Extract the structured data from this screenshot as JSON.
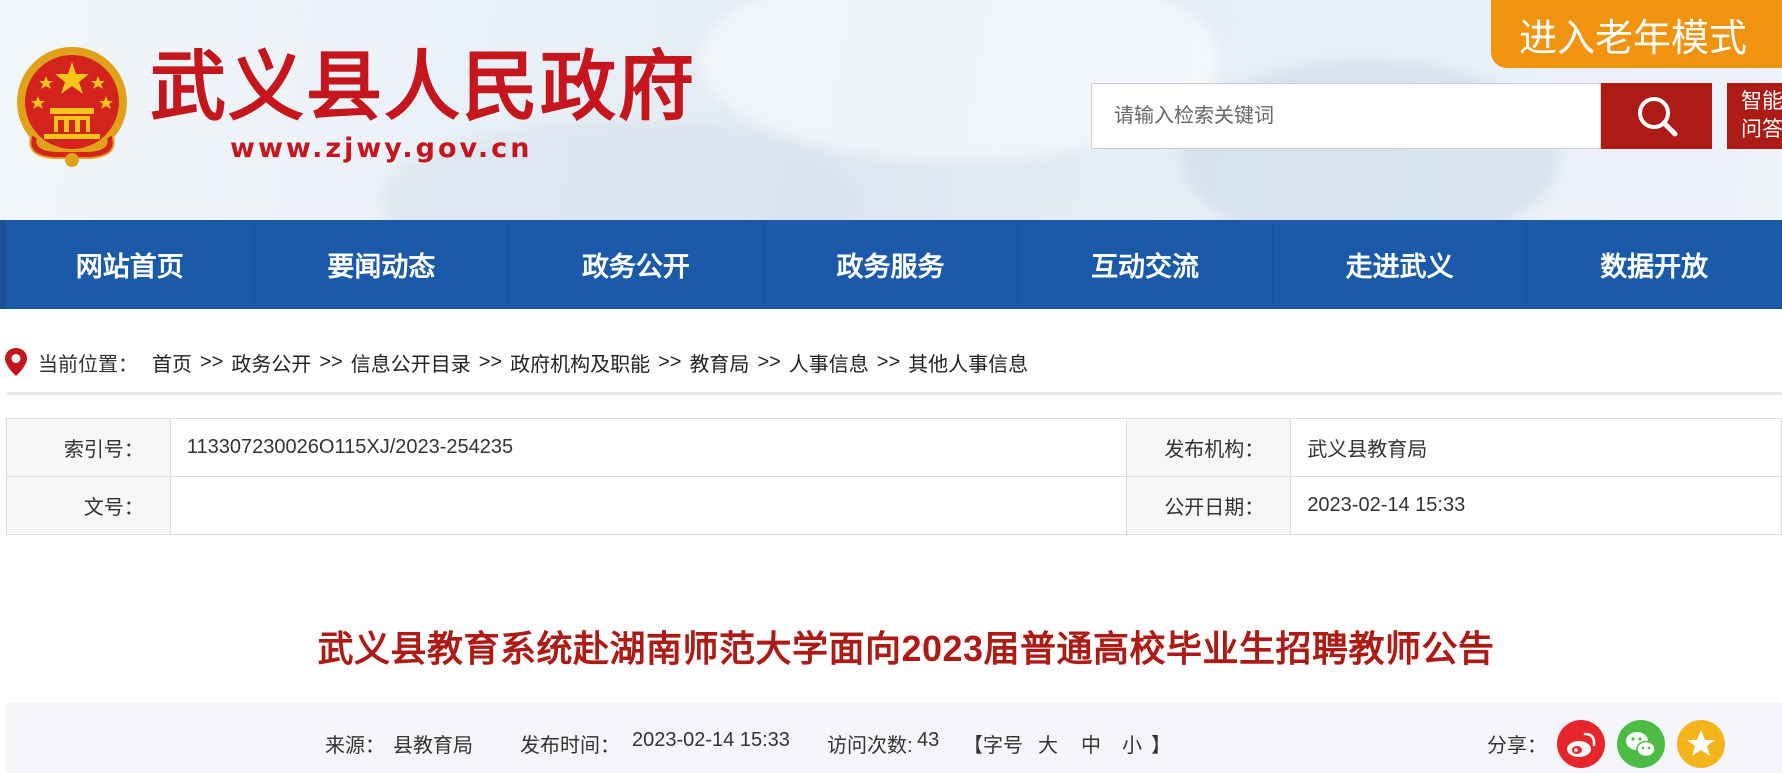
{
  "header": {
    "site_title": "武义县人民政府",
    "site_url": "www.zjwy.gov.cn",
    "elder_mode_label": "进入老年模式",
    "search_placeholder": "请输入检索关键词",
    "ai_label_line1": "智能",
    "ai_label_line2": "问答"
  },
  "nav": {
    "items": [
      "网站首页",
      "要闻动态",
      "政务公开",
      "政务服务",
      "互动交流",
      "走进武义",
      "数据开放"
    ]
  },
  "breadcrumb": {
    "label": "当前位置：",
    "separator": ">>",
    "items": [
      "首页",
      "政务公开",
      "信息公开目录",
      "政府机构及职能",
      "教育局",
      "人事信息",
      "其他人事信息"
    ]
  },
  "meta": {
    "index_label": "索引号：",
    "index_value": "113307230026O115XJ/2023-254235",
    "publisher_label": "发布机构：",
    "publisher_value": "武义县教育局",
    "doc_no_label": "文号：",
    "doc_no_value": "",
    "date_label": "公开日期：",
    "date_value": "2023-02-14 15:33"
  },
  "article": {
    "title": "武义县教育系统赴湖南师范大学面向2023届普通高校毕业生招聘教师公告"
  },
  "info": {
    "source_label": "来源：",
    "source_value": "县教育局",
    "time_label": "发布时间：",
    "time_value": "2023-02-14 15:33",
    "visits_label": "访问次数:",
    "visits_value": "43",
    "font_prefix": "【字号",
    "font_large": "大",
    "font_medium": "中",
    "font_small": "小",
    "font_suffix": "】",
    "share_label": "分享："
  },
  "colors": {
    "brand_red": "#c4161c",
    "nav_blue": "#1a5aa8",
    "elder_orange": "#f0930e",
    "weibo": "#e6262a",
    "wechat": "#4cbc45",
    "qzone": "#f4b41c"
  }
}
